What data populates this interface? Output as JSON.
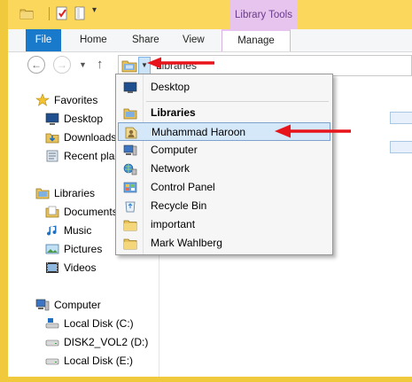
{
  "ribbon": {
    "contextual_group": "Library Tools",
    "tabs": {
      "file": "File",
      "home": "Home",
      "share": "Share",
      "view": "View",
      "manage": "Manage"
    }
  },
  "address": {
    "crumb": "Libraries",
    "crumb_sep": "▸"
  },
  "dropdown": {
    "items": [
      {
        "label": "Desktop",
        "icon": "desktop-icon"
      },
      {
        "label": "Libraries",
        "icon": "libraries-icon",
        "bold": true
      },
      {
        "label": "Muhammad Haroon",
        "icon": "user-folder-icon",
        "highlighted": true
      },
      {
        "label": "Computer",
        "icon": "computer-icon"
      },
      {
        "label": "Network",
        "icon": "network-icon"
      },
      {
        "label": "Control Panel",
        "icon": "control-panel-icon"
      },
      {
        "label": "Recycle Bin",
        "icon": "recycle-bin-icon"
      },
      {
        "label": "important",
        "icon": "folder-icon"
      },
      {
        "label": "Mark Wahlberg",
        "icon": "folder-icon"
      }
    ]
  },
  "navpane": {
    "favorites": {
      "header": "Favorites",
      "items": [
        "Desktop",
        "Downloads",
        "Recent plac"
      ]
    },
    "libraries": {
      "header": "Libraries",
      "items": [
        "Documents",
        "Music",
        "Pictures",
        "Videos"
      ]
    },
    "computer": {
      "header": "Computer",
      "items": [
        "Local Disk (C:)",
        "DISK2_VOL2 (D:)",
        "Local Disk (E:)"
      ]
    }
  },
  "colors": {
    "title_bar": "#fbd75b",
    "file_tab": "#1979ca",
    "contextual": "#e7c4ee",
    "highlight": "#d5e8f9",
    "annotation_arrow": "#e8141b"
  }
}
